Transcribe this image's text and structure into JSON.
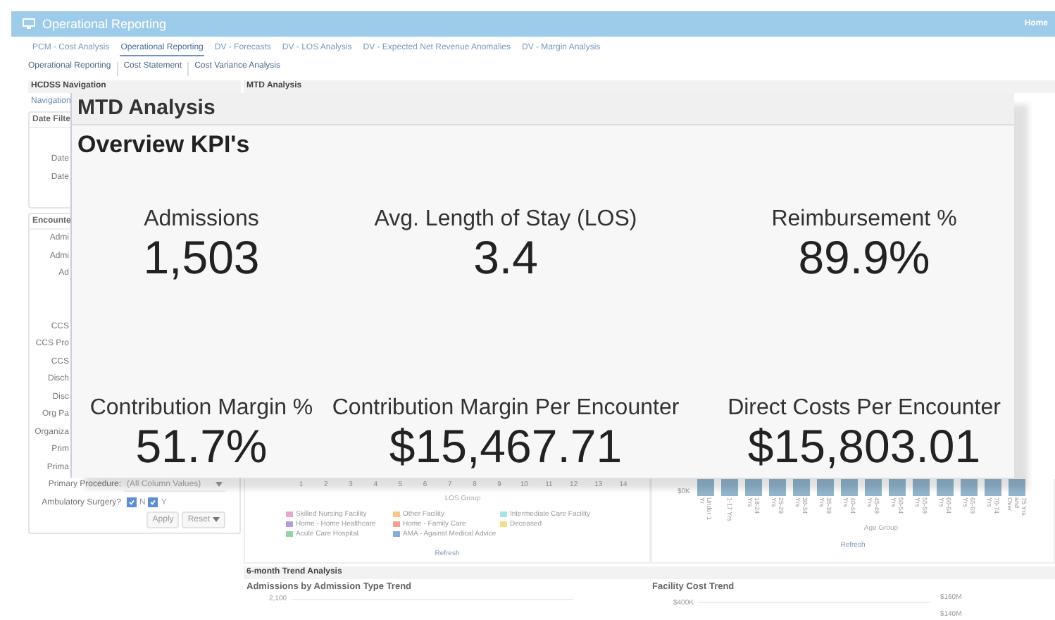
{
  "header": {
    "title": "Operational Reporting",
    "home_link": "Home"
  },
  "tabs": [
    {
      "label": "PCM - Cost Analysis",
      "selected": false
    },
    {
      "label": "Operational Reporting",
      "selected": true
    },
    {
      "label": "DV - Forecasts",
      "selected": false
    },
    {
      "label": "DV - LOS Analysis",
      "selected": false
    },
    {
      "label": "DV - Expected Net Revenue Anomalies",
      "selected": false
    },
    {
      "label": "DV - Margin Analysis",
      "selected": false
    }
  ],
  "subtabs": [
    "Operational Reporting",
    "Cost Statement",
    "Cost Variance Analysis"
  ],
  "sidebar": {
    "title": "HCDSS Navigation",
    "nav_link": "Navigation",
    "date_filters": {
      "title": "Date Filte",
      "rows": [
        {
          "kind": "covered",
          "label": "Date"
        },
        {
          "kind": "covered",
          "label": "Date"
        }
      ]
    },
    "encounter_filters": {
      "title": "Encounte",
      "rows": [
        {
          "kind": "covered",
          "label": "Admi"
        },
        {
          "kind": "covered",
          "label": "Admi"
        },
        {
          "kind": "covered",
          "label": "Ad"
        },
        {
          "kind": "hidden"
        },
        {
          "kind": "hidden"
        },
        {
          "kind": "covered",
          "label": "CCS"
        },
        {
          "kind": "covered",
          "label": "CCS Pro"
        },
        {
          "kind": "covered",
          "label": "CCS"
        },
        {
          "kind": "covered",
          "label": "Disch"
        },
        {
          "kind": "covered",
          "label": "Disc"
        },
        {
          "kind": "covered",
          "label": "Org Pa"
        },
        {
          "kind": "covered",
          "label": "Organiza"
        },
        {
          "kind": "covered",
          "label": "Prim"
        },
        {
          "kind": "covered",
          "label": "Prima"
        },
        {
          "kind": "select",
          "label": "Primary Procedure:",
          "value": "(All Column Values)"
        },
        {
          "kind": "checkboxes",
          "label": "Ambulatory Surgery?",
          "options": [
            {
              "label": "N",
              "checked": true
            },
            {
              "label": "Y",
              "checked": true
            }
          ]
        }
      ],
      "buttons": [
        "Apply",
        "Reset"
      ]
    }
  },
  "mtd_analysis": {
    "title": "MTD Analysis",
    "los_chart": {
      "x_ticks": [
        "1",
        "2",
        "3",
        "4",
        "5",
        "6",
        "7",
        "8",
        "9",
        "10",
        "11",
        "12",
        "13",
        "14"
      ],
      "xlabel": "LOS Group",
      "legend": [
        {
          "label": "Skilled Nursing Facility",
          "color": "#e8a6cf"
        },
        {
          "label": "Other Facility",
          "color": "#f5c58a"
        },
        {
          "label": "Intermediate Care Facility",
          "color": "#a6e3e6"
        },
        {
          "label": "Home - Home Healthcare",
          "color": "#b39ddb"
        },
        {
          "label": "Home - Family Care",
          "color": "#f0a08e"
        },
        {
          "label": "Deceased",
          "color": "#f5dc8c"
        },
        {
          "label": "Acute Care Hospital",
          "color": "#97d3a4"
        },
        {
          "label": "AMA - Against Medical Advice",
          "color": "#86aed3"
        }
      ],
      "refresh": "Refresh"
    },
    "direct_costs_chart": {
      "y_tick": "$0K",
      "categories": [
        "Under 1 Yr",
        "1-17 Yrs",
        "18-24 Yrs",
        "25-29 Yrs",
        "30-34 Yrs",
        "35-39 Yrs",
        "40-44 Yrs",
        "45-49 Yrs",
        "50-54 Yrs",
        "55-59 Yrs",
        "60-64 Yrs",
        "65-69 Yrs",
        "70-74 Yrs",
        "75 Yrs and Over"
      ],
      "xlabel": "Age Group",
      "refresh": "Refresh"
    }
  },
  "trend_analysis": {
    "title": "6-month Trend Analysis",
    "admissions_trend": {
      "title": "Admissions by Admission Type Trend",
      "y_ticks": [
        "2,100"
      ]
    },
    "facility_cost_trend": {
      "title": "Facility Cost Trend",
      "left_ticks": [
        "$400K"
      ],
      "right_ticks": [
        "$160M",
        "$140M"
      ]
    }
  },
  "overlay": {
    "title": "MTD Analysis",
    "subtitle": "Overview KPI's",
    "kpis": [
      {
        "label": "Admissions",
        "value": "1,503"
      },
      {
        "label": "Avg. Length of Stay (LOS)",
        "value": "3.4"
      },
      {
        "label": "Reimbursement %",
        "value": "89.9%"
      },
      {
        "label": "Contribution Margin %",
        "value": "51.7%"
      },
      {
        "label": "Contribution Margin Per Encounter",
        "value": "$15,467.71"
      },
      {
        "label": "Direct Costs Per Encounter",
        "value": "$15,803.01"
      }
    ]
  }
}
